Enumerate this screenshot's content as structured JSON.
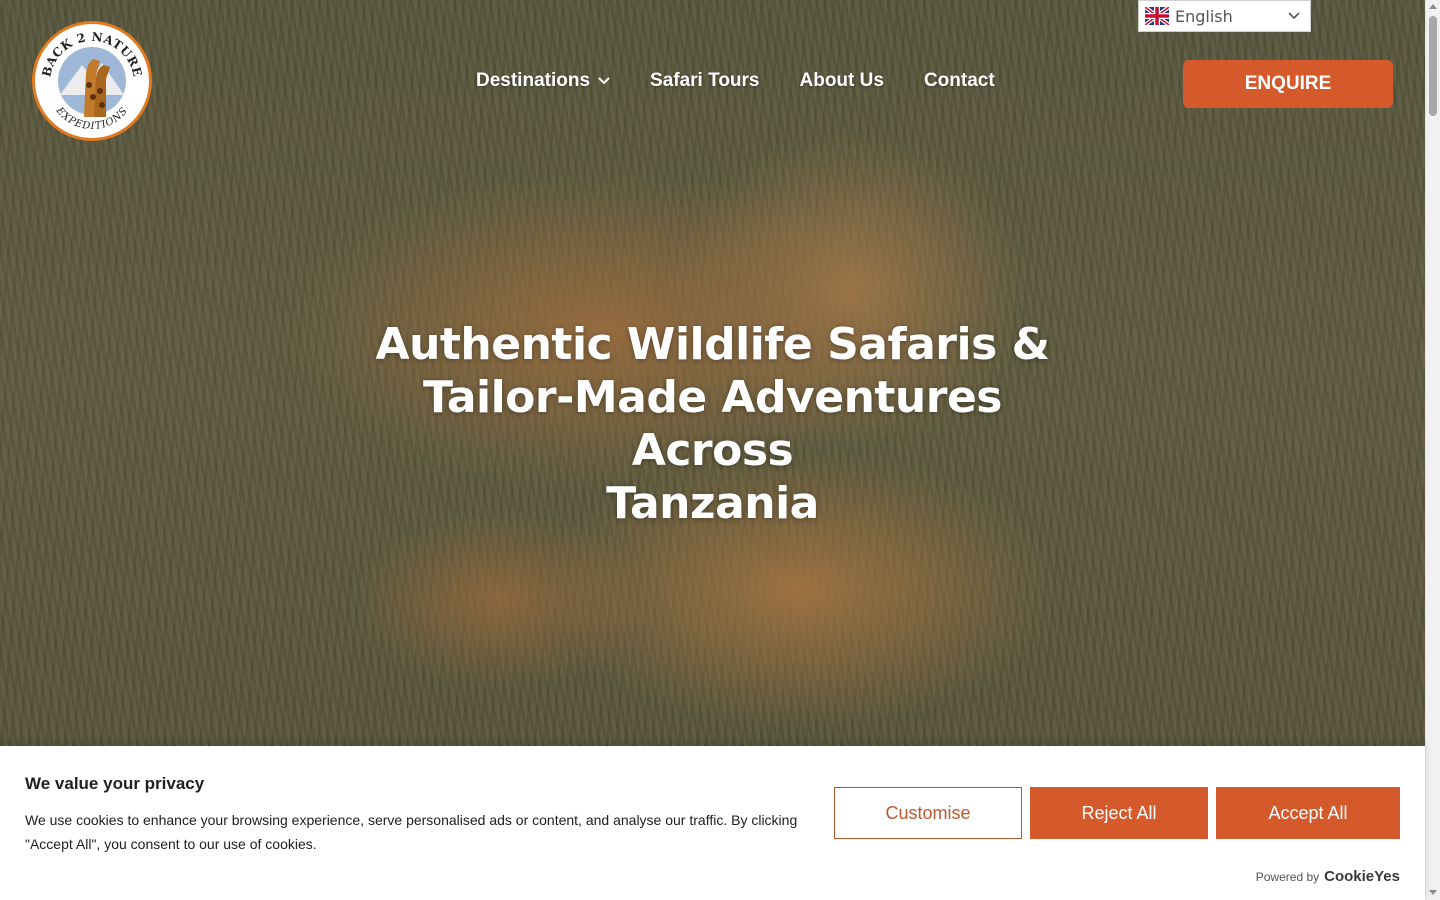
{
  "logo": {
    "line1": "BACK 2 NATURE",
    "line2": "EXPEDITIONS",
    "accent": "#e07a1f"
  },
  "language": {
    "selected": "English",
    "flag_icon": "uk-flag-icon"
  },
  "nav": {
    "items": [
      {
        "label": "Destinations",
        "has_dropdown": true
      },
      {
        "label": "Safari Tours"
      },
      {
        "label": "About Us"
      },
      {
        "label": "Contact"
      }
    ],
    "enquire_label": "ENQUIRE",
    "accent": "#d45a2c"
  },
  "hero": {
    "title_line1": "Authentic Wildlife Safaris &",
    "title_line2": "Tailor-Made Adventures Across",
    "title_line3": "Tanzania"
  },
  "cookie": {
    "title": "We value your privacy",
    "text": "We use cookies to enhance your browsing experience, serve personalised ads or content, and analyse our traffic. By clicking \"Accept All\", you consent to our use of cookies.",
    "customise_label": "Customise",
    "reject_label": "Reject All",
    "accept_label": "Accept All",
    "powered_by": "Powered by",
    "brand": "CookieYes"
  }
}
